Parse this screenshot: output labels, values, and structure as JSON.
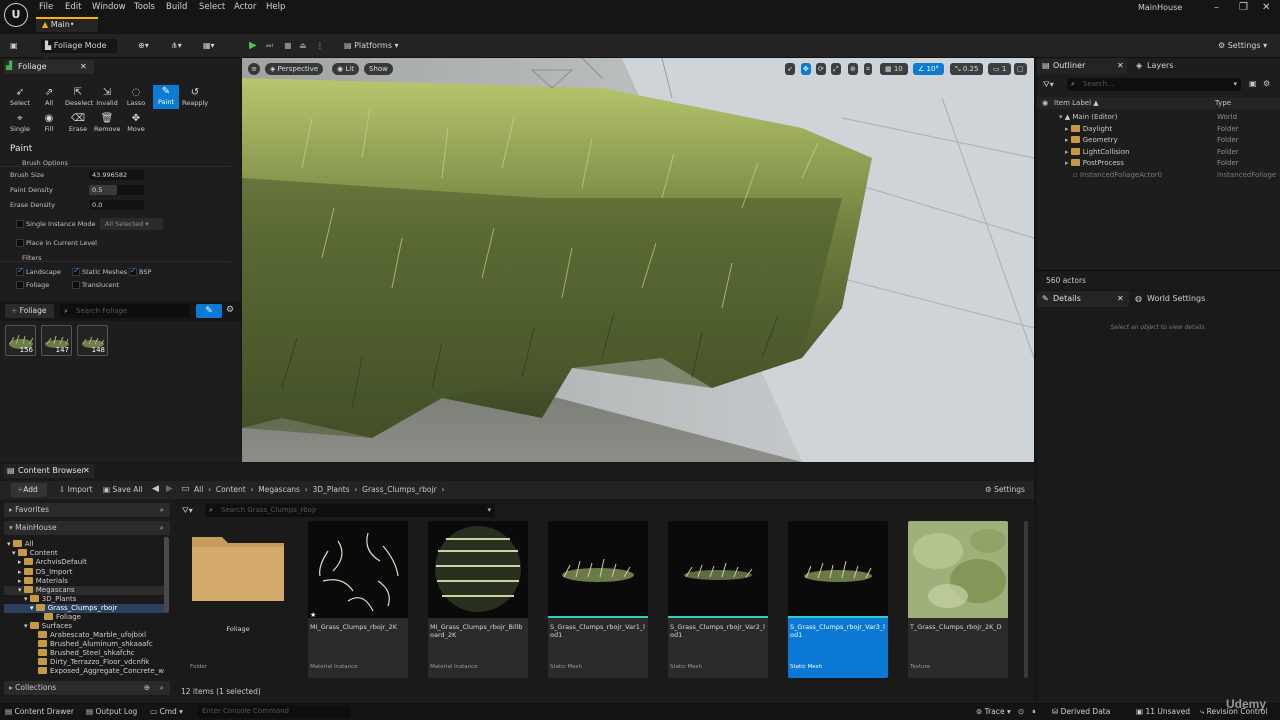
{
  "menu": {
    "items": [
      "File",
      "Edit",
      "Window",
      "Tools",
      "Build",
      "Select",
      "Actor",
      "Help"
    ],
    "project": "MainHouse"
  },
  "doc_tab": "Main•",
  "toolbar": {
    "mode": "Foliage Mode",
    "platforms": "Platforms",
    "settings": "Settings"
  },
  "foliage": {
    "tab": "Foliage",
    "tools_row1": [
      "Select",
      "All",
      "Deselect",
      "Invalid",
      "Lasso",
      "Paint",
      "Reapply"
    ],
    "tools_row2": [
      "Single",
      "Fill",
      "Erase",
      "Remove",
      "Move"
    ],
    "active_tool": "Paint",
    "section": "Paint",
    "brush_options": "Brush Options",
    "brush_size_label": "Brush Size",
    "brush_size": "43.996582",
    "paint_density_label": "Paint Density",
    "paint_density": "0.5",
    "paint_density_fraction": 0.5,
    "erase_density_label": "Erase Density",
    "erase_density": "0.0",
    "single_instance_label": "Single Instance Mode",
    "single_instance_select": "All Selected",
    "place_level_label": "Place in Current Level",
    "filters_label": "Filters",
    "filters": {
      "landscape": "Landscape",
      "static_meshes": "Static Meshes",
      "bsp": "BSP",
      "foliage": "Foliage",
      "translucent": "Translucent"
    },
    "add_button": "Foliage",
    "search_placeholder": "Search Foliage",
    "thumbs": [
      "156",
      "147",
      "148"
    ]
  },
  "viewport": {
    "perspective": "Perspective",
    "lit": "Lit",
    "show": "Show",
    "grid": "10",
    "angle": "10°",
    "scale": "0.25",
    "camera": "1"
  },
  "outliner": {
    "tab": "Outliner",
    "layers_tab": "Layers",
    "search_placeholder": "Search...",
    "col_label": "Item Label ▲",
    "col_type": "Type",
    "rows": [
      {
        "label": "Main (Editor)",
        "type": "World"
      },
      {
        "label": "Daylight",
        "type": "Folder"
      },
      {
        "label": "Geometry",
        "type": "Folder"
      },
      {
        "label": "LightCollision",
        "type": "Folder"
      },
      {
        "label": "PostProcess",
        "type": "Folder"
      },
      {
        "label": "InstancedFoliageActor0",
        "type": "InstancedFoliage"
      }
    ],
    "count": "560 actors"
  },
  "details": {
    "tab": "Details",
    "world_tab": "World Settings",
    "hint": "Select an object to view details."
  },
  "content_browser": {
    "tab": "Content Browser",
    "add": "Add",
    "import": "Import",
    "save_all": "Save All",
    "settings": "Settings",
    "breadcrumb": [
      "All",
      "Content",
      "Megascans",
      "3D_Plants",
      "Grass_Clumps_rbojr"
    ],
    "favorites": "Favorites",
    "project": "MainHouse",
    "collections": "Collections",
    "search_placeholder": "Search Grass_Clumps_rbojr",
    "tree": [
      "All",
      "Content",
      "ArchvisDefault",
      "DS_Import",
      "Materials",
      "Megascans",
      "3D_Plants",
      "Grass_Clumps_rbojr",
      "Foliage",
      "Surfaces",
      "Arabescato_Marble_ufojbixl",
      "Brushed_Aluminum_shkaaafc",
      "Brushed_Steel_shkafchc",
      "Dirty_Terrazzo_Floor_vdcnfik",
      "Exposed_Aggregate_Concrete_w"
    ],
    "assets": [
      {
        "name": "Foliage",
        "kind": "Folder"
      },
      {
        "name": "MI_Grass_Clumps_rbojr_2K",
        "kind": "Material Instance"
      },
      {
        "name": "MI_Grass_Clumps_rbojr_Billboard_2K",
        "kind": "Material Instance"
      },
      {
        "name": "S_Grass_Clumps_rbojr_Var1_lod1",
        "kind": "Static Mesh"
      },
      {
        "name": "S_Grass_Clumps_rbojr_Var2_lod1",
        "kind": "Static Mesh"
      },
      {
        "name": "S_Grass_Clumps_rbojr_Var3_lod1",
        "kind": "Static Mesh"
      },
      {
        "name": "T_Grass_Clumps_rbojr_2K_D",
        "kind": "Texture"
      }
    ],
    "item_count": "12 items (1 selected)"
  },
  "statusbar": {
    "content_drawer": "Content Drawer",
    "output_log": "Output Log",
    "cmd": "Cmd",
    "console_placeholder": "Enter Console Command",
    "trace": "Trace",
    "derived_data": "Derived Data",
    "unsaved": "11 Unsaved",
    "revision": "Revision Control"
  },
  "watermark": "Udemy"
}
